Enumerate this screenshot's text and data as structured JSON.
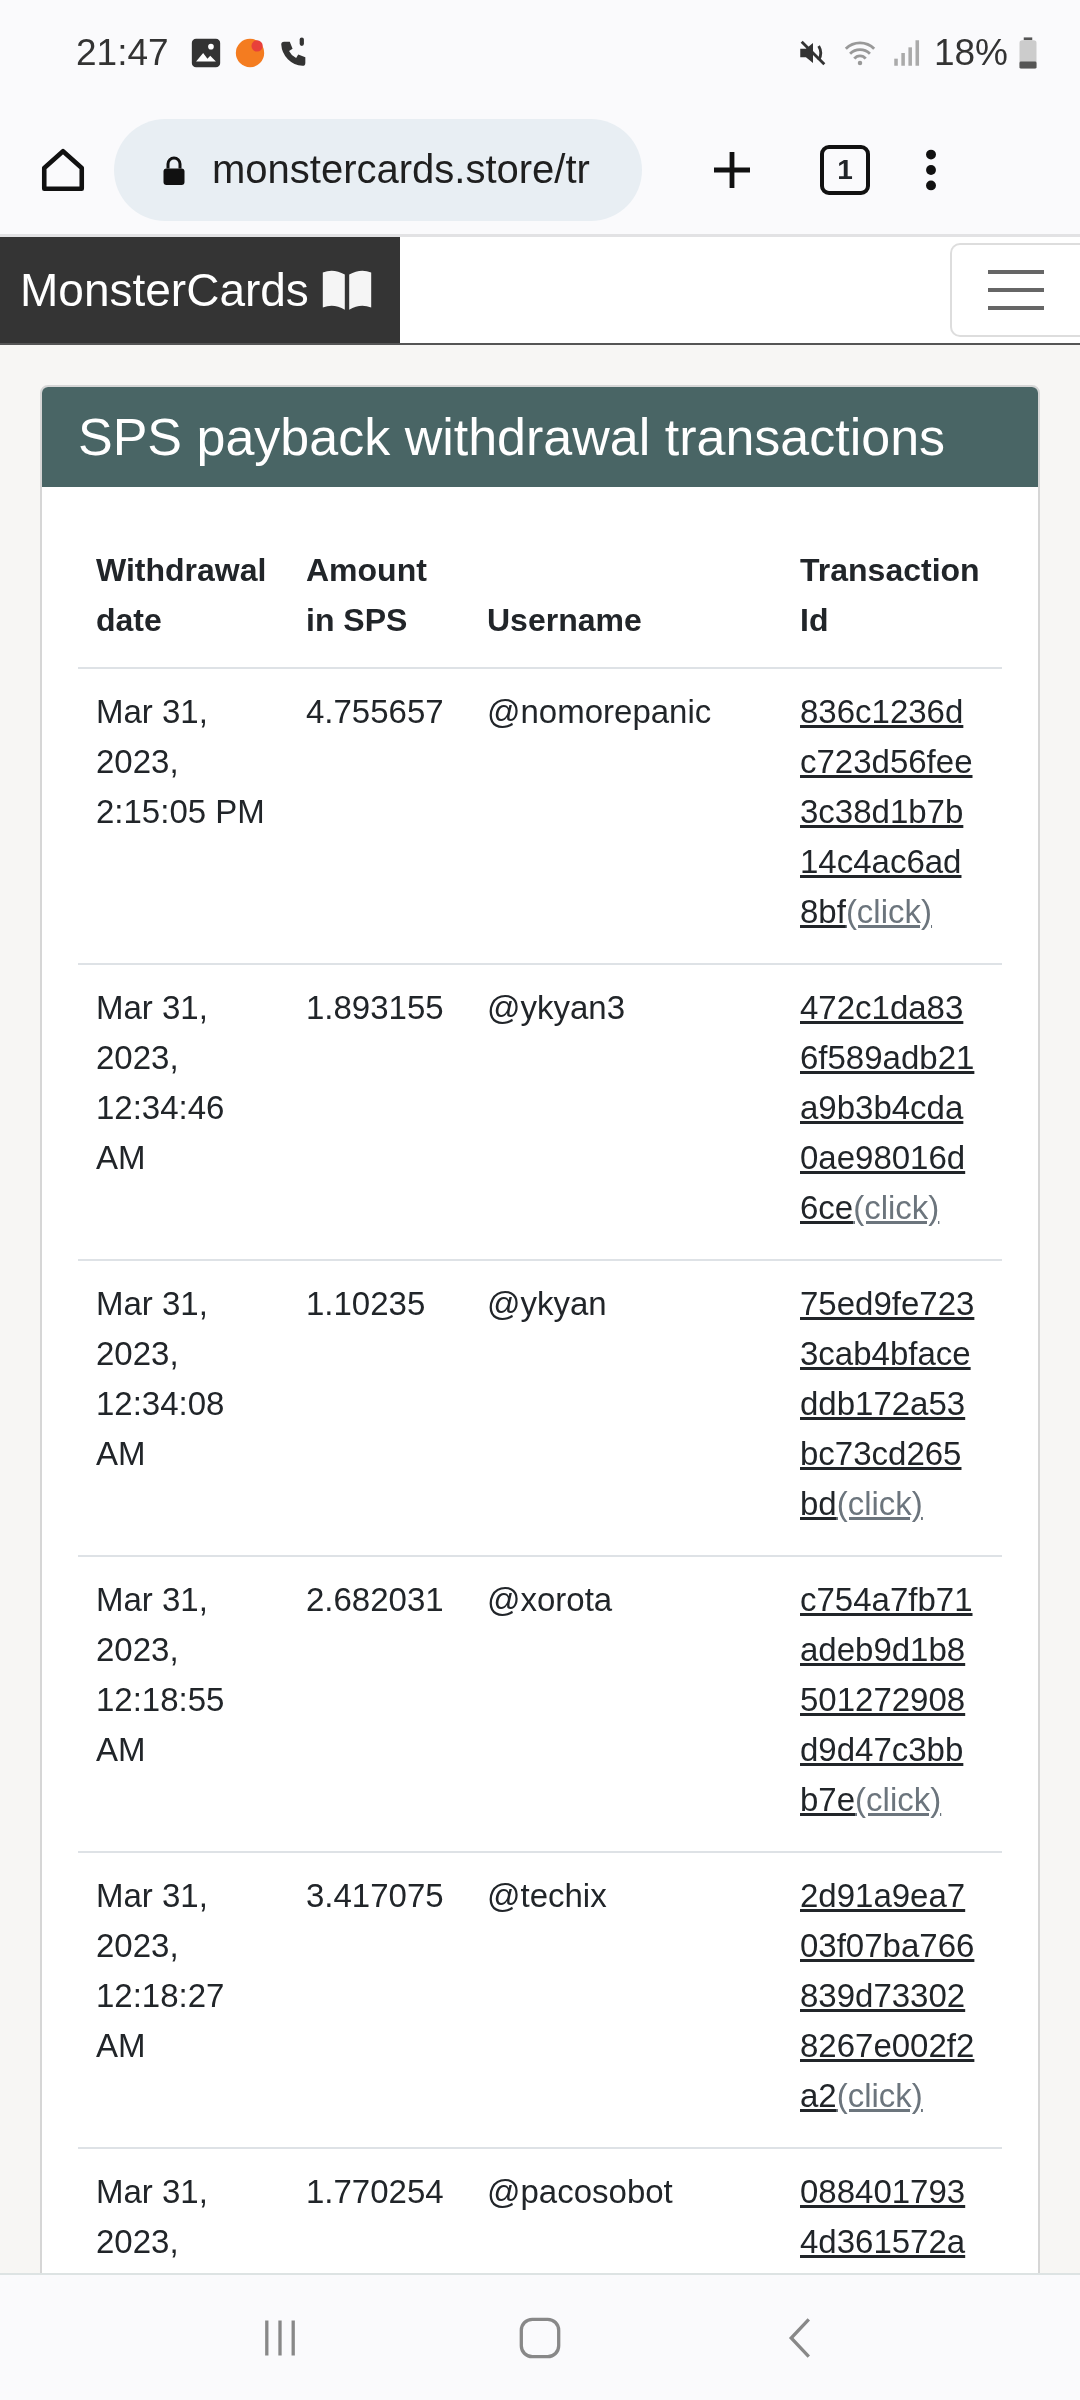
{
  "status_bar": {
    "time": "21:47",
    "battery": "18%"
  },
  "browser": {
    "url": "monstercards.store/tr",
    "tab_count": "1"
  },
  "navbar": {
    "brand": "MonsterCards"
  },
  "card": {
    "title": "SPS payback withdrawal transactions"
  },
  "table": {
    "columns": [
      "Withdrawal date",
      "Amount in SPS",
      "Username",
      "Transaction Id"
    ],
    "rows": [
      {
        "date": "Mar 31, 2023, 2:15:05 PM",
        "amount": "4.755657",
        "username": "@nomorepanic",
        "transaction_id_lines": [
          "836c1236d",
          "c723d56fee",
          "3c38d1b7b",
          "14c4ac6ad",
          "8bf"
        ],
        "link": "(click)"
      },
      {
        "date": "Mar 31, 2023, 12:34:46 AM",
        "amount": "1.893155",
        "username": "@ykyan3",
        "transaction_id_lines": [
          "472c1da83",
          "6f589adb21",
          "a9b3b4cda",
          "0ae98016d",
          "6ce"
        ],
        "link": "(click)"
      },
      {
        "date": "Mar 31, 2023, 12:34:08 AM",
        "amount": "1.10235",
        "username": "@ykyan",
        "transaction_id_lines": [
          "75ed9fe723",
          "3cab4bface",
          "ddb172a53",
          "bc73cd265",
          "bd"
        ],
        "link": "(click)"
      },
      {
        "date": "Mar 31, 2023, 12:18:55 AM",
        "amount": "2.682031",
        "username": "@xorota",
        "transaction_id_lines": [
          "c754a7fb71",
          "adeb9d1b8",
          "501272908",
          "d9d47c3bb",
          "b7e"
        ],
        "link": "(click)"
      },
      {
        "date": "Mar 31, 2023, 12:18:27 AM",
        "amount": "3.417075",
        "username": "@techix",
        "transaction_id_lines": [
          "2d91a9ea7",
          "03f07ba766",
          "839d73302",
          "8267e002f2",
          "a2"
        ],
        "link": "(click)"
      },
      {
        "date": "Mar 31, 2023,",
        "amount": "1.770254",
        "username": "@pacosobot",
        "transaction_id_lines": [
          "088401793",
          "4d361572a"
        ]
      }
    ]
  }
}
